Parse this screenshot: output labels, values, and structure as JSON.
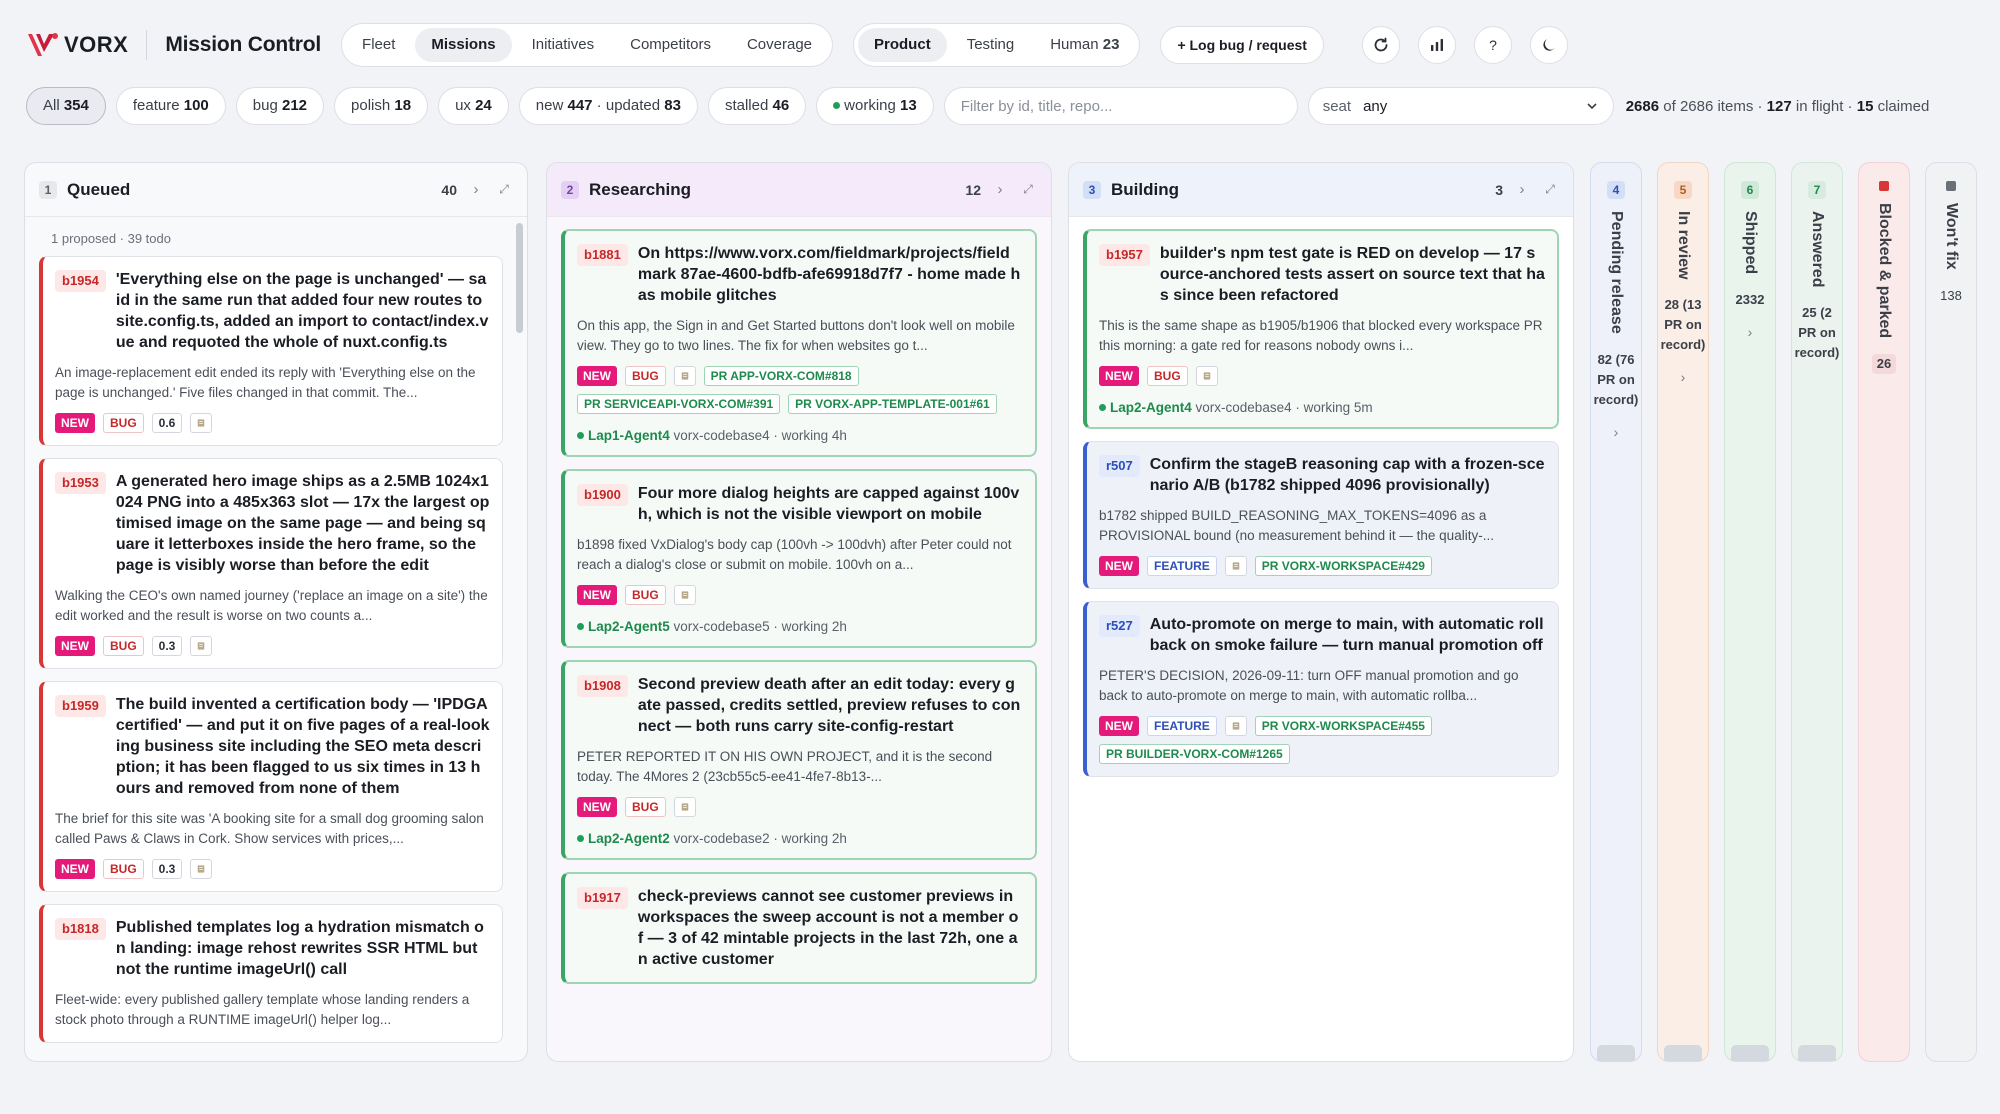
{
  "header": {
    "logo_text": "VORX",
    "app_title": "Mission Control",
    "nav_tabs": [
      {
        "label": "Fleet"
      },
      {
        "label": "Missions"
      },
      {
        "label": "Initiatives"
      },
      {
        "label": "Competitors"
      },
      {
        "label": "Coverage"
      }
    ],
    "view_tabs": [
      {
        "label": "Product"
      },
      {
        "label": "Testing"
      },
      {
        "label": "Human",
        "count": "23"
      }
    ],
    "log_button": "+ Log bug / request"
  },
  "filters": {
    "chips": [
      {
        "label": "All",
        "count": "354"
      },
      {
        "label": "feature",
        "count": "100"
      },
      {
        "label": "bug",
        "count": "212"
      },
      {
        "label": "polish",
        "count": "18"
      },
      {
        "label": "ux",
        "count": "24"
      },
      {
        "label": "new",
        "count": "447",
        "label2": "updated",
        "count2": "83"
      },
      {
        "label": "stalled",
        "count": "46"
      },
      {
        "label": "working",
        "count": "13"
      }
    ],
    "search_placeholder": "Filter by id, title, repo...",
    "seat_label": "seat",
    "seat_value": "any",
    "summary": {
      "shown": "2686",
      "of_text": "of 2686 items ·",
      "in_flight": "127",
      "in_flight_text": "in flight ·",
      "claimed": "15",
      "claimed_text": "claimed"
    }
  },
  "columns": {
    "queued": {
      "index": "1",
      "title": "Queued",
      "count": "40",
      "subnote": "1 proposed · 39 todo",
      "cards": [
        {
          "id": "b1954",
          "title": "'Everything else on the page is unchanged' — said in the same run that added four new routes to site.config.ts, added an import to contact/index.vue and requoted the whole of nuxt.config.ts",
          "desc": "An image-replacement edit ended its reply with 'Everything else on the page is unchanged.' Five files changed in that commit. The...",
          "score": "0.6"
        },
        {
          "id": "b1953",
          "title": "A generated hero image ships as a 2.5MB 1024x1024 PNG into a 485x363 slot — 17x the largest optimised image on the same page — and being square it letterboxes inside the hero frame, so the page is visibly worse than before the edit",
          "desc": "Walking the CEO's own named journey ('replace an image on a site') the edit worked and the result is worse on two counts a...",
          "score": "0.3"
        },
        {
          "id": "b1959",
          "title": "The build invented a certification body — 'IPDGA certified' — and put it on five pages of a real-looking business site including the SEO meta description; it has been flagged to us six times in 13 hours and removed from none of them",
          "desc": "The brief for this site was 'A booking site for a small dog grooming salon called Paws & Claws in Cork. Show services with prices,...",
          "score": "0.3"
        },
        {
          "id": "b1818",
          "title": "Published templates log a hydration mismatch on landing: image rehost rewrites SSR HTML but not the runtime imageUrl() call",
          "desc": "Fleet-wide: every published gallery template whose landing renders a stock photo through a RUNTIME imageUrl() helper log..."
        }
      ]
    },
    "researching": {
      "index": "2",
      "title": "Researching",
      "count": "12",
      "cards": [
        {
          "id": "b1881",
          "title": "On https://www.vorx.com/fieldmark/projects/fieldmark 87ae-4600-bdfb-afe69918d7f7 - home made has mobile glitches",
          "desc": "On this app, the Sign in and Get Started buttons don't look well on mobile view. They go to two lines. The fix for when websites go t...",
          "prs": [
            "PR APP-VORX-COM#818",
            "PR SERVICEAPI-VORX-COM#391",
            "PR VORX-APP-TEMPLATE-001#61"
          ],
          "agent": "Lap1-Agent4",
          "repo": "vorx-codebase4 · working 4h"
        },
        {
          "id": "b1900",
          "title": "Four more dialog heights are capped against 100vh, which is not the visible viewport on mobile",
          "desc": "b1898 fixed VxDialog's body cap (100vh -> 100dvh) after Peter could not reach a dialog's close or submit on mobile. 100vh on a...",
          "prs": [],
          "agent": "Lap2-Agent5",
          "repo": "vorx-codebase5 · working 2h"
        },
        {
          "id": "b1908",
          "title": "Second preview death after an edit today: every gate passed, credits settled, preview refuses to connect — both runs carry site-config-restart",
          "desc": "PETER REPORTED IT ON HIS OWN PROJECT, and it is the second today. The 4Mores 2 (23cb55c5-ee41-4fe7-8b13-...",
          "prs": [],
          "agent": "Lap2-Agent2",
          "repo": "vorx-codebase2 · working 2h"
        },
        {
          "id": "b1917",
          "title": "check-previews cannot see customer previews in workspaces the sweep account is not a member of — 3 of 42 mintable projects in the last 72h, one an active customer",
          "desc": ""
        }
      ]
    },
    "building": {
      "index": "3",
      "title": "Building",
      "count": "3",
      "cards": [
        {
          "id": "b1957",
          "kind": "bug",
          "title": "builder's npm test gate is RED on develop — 17 source-anchored tests assert on source text that has since been refactored",
          "desc": "This is the same shape as b1905/b1906 that blocked every workspace PR this morning: a gate red for reasons nobody owns i...",
          "prs": [],
          "agent": "Lap2-Agent4",
          "repo": "vorx-codebase4 · working 5m"
        },
        {
          "id": "r507",
          "kind": "feature",
          "title": "Confirm the stageB reasoning cap with a frozen-scenario A/B (b1782 shipped 4096 provisionally)",
          "desc": "b1782 shipped BUILD_REASONING_MAX_TOKENS=4096 as a PROVISIONAL bound (no measurement behind it — the quality-...",
          "prs": [
            "PR VORX-WORKSPACE#429"
          ]
        },
        {
          "id": "r527",
          "kind": "feature",
          "title": "Auto-promote on merge to main, with automatic rollback on smoke failure — turn manual promotion off",
          "desc": "PETER'S DECISION, 2026-09-11: turn OFF manual promotion and go back to auto-promote on merge to main, with automatic rollba...",
          "prs": [
            "PR VORX-WORKSPACE#455",
            "PR BUILDER-VORX-COM#1265"
          ]
        }
      ]
    },
    "narrow": [
      {
        "index": "4",
        "title": "Pending release",
        "count": "82 (76 PR on record)",
        "accent": "#3a5fcf"
      },
      {
        "index": "5",
        "title": "In review",
        "count": "28 (13 PR on record)",
        "accent": "#d27a2c"
      },
      {
        "index": "6",
        "title": "Shipped",
        "count": "2332",
        "accent": "#3aa564"
      },
      {
        "index": "7",
        "title": "Answered",
        "count": "25 (2 PR on record)",
        "accent": "#3aa564"
      },
      {
        "index": "",
        "title": "Blocked & parked",
        "count": "26",
        "accent": "#d93737"
      },
      {
        "index": "",
        "title": "Won't fix",
        "count": "138",
        "accent": "#6a6f78"
      }
    ]
  },
  "tags": {
    "new": "NEW",
    "bug": "BUG",
    "feature": "FEATURE"
  },
  "colors": {
    "accent_bug": "#d93737",
    "accent_new": "#e5197a",
    "accent_green": "#3aa564",
    "accent_blue": "#3a5fcf"
  }
}
